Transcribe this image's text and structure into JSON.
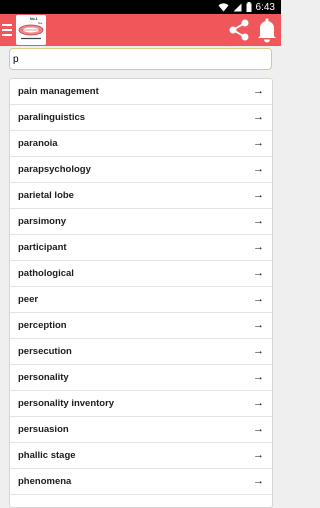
{
  "status": {
    "time": "6:43"
  },
  "search": {
    "value": "p"
  },
  "terms": [
    "pain management",
    "paralinguistics",
    "paranoia",
    "parapsychology",
    "parietal lobe",
    "parsimony",
    "participant",
    "pathological",
    "peer",
    "perception",
    "persecution",
    "personality",
    "personality inventory",
    "persuasion",
    "phallic stage",
    "phenomena",
    ""
  ],
  "colors": {
    "app_bar": "#f0575a",
    "status_bar": "#000000"
  },
  "icons": {
    "menu": "menu-icon",
    "share": "share-icon",
    "bell": "bell-icon",
    "row_arrow": "arrow-right-icon"
  }
}
